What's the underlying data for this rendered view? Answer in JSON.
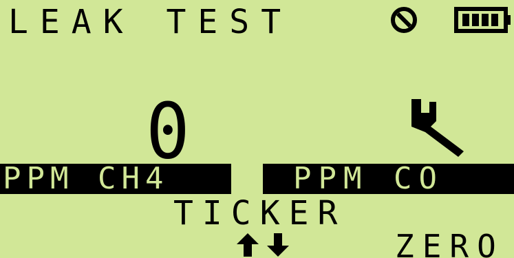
{
  "screen": {
    "title": "LEAK TEST",
    "status_icons": [
      "no-sensor-icon",
      "battery-icon"
    ],
    "battery_level": 1.0
  },
  "main": {
    "reading_value": "0",
    "fault_icon": "wrench-icon",
    "left_unit_label": "PPM CH4",
    "right_unit_label": "PPM CO",
    "mode_label": "TICKER"
  },
  "softkeys": {
    "navigation_icon": "up-down-arrows-icon",
    "right_label": "ZERO"
  },
  "colors": {
    "lcd_background": "#d1e797",
    "segment_foreground": "#000000"
  }
}
